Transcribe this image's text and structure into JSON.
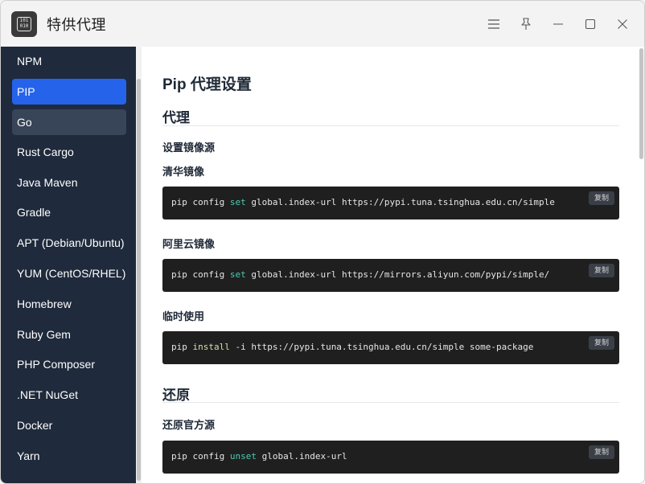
{
  "window": {
    "title": "特供代理",
    "app_icon_text": "101\n010"
  },
  "sidebar": {
    "items": [
      {
        "label": "NPM",
        "state": "normal"
      },
      {
        "label": "PIP",
        "state": "active"
      },
      {
        "label": "Go",
        "state": "hover"
      },
      {
        "label": "Rust Cargo",
        "state": "normal"
      },
      {
        "label": "Java Maven",
        "state": "normal"
      },
      {
        "label": "Gradle",
        "state": "normal"
      },
      {
        "label": "APT (Debian/Ubuntu)",
        "state": "normal"
      },
      {
        "label": "YUM (CentOS/RHEL)",
        "state": "normal"
      },
      {
        "label": "Homebrew",
        "state": "normal"
      },
      {
        "label": "Ruby Gem",
        "state": "normal"
      },
      {
        "label": "PHP Composer",
        "state": "normal"
      },
      {
        "label": ".NET NuGet",
        "state": "normal"
      },
      {
        "label": "Docker",
        "state": "normal"
      },
      {
        "label": "Yarn",
        "state": "normal"
      }
    ]
  },
  "main": {
    "page_title": "Pip 代理设置",
    "sections": [
      {
        "title": "代理",
        "subtitle": "设置镜像源",
        "blocks": [
          {
            "label": "清华镜像",
            "code_prefix": "pip config ",
            "code_keyword": "set",
            "code_rest": " global.index-url https://pypi.tuna.tsinghua.edu.cn/simple",
            "copy_label": "复制"
          },
          {
            "label": "阿里云镜像",
            "code_prefix": "pip config ",
            "code_keyword": "set",
            "code_rest": " global.index-url https://mirrors.aliyun.com/pypi/simple/",
            "copy_label": "复制"
          },
          {
            "label": "临时使用",
            "code_prefix": "pip ",
            "code_keyword": "install",
            "code_rest": " -i https://pypi.tuna.tsinghua.edu.cn/simple some-package",
            "copy_label": "复制"
          }
        ]
      },
      {
        "title": "还原",
        "blocks": [
          {
            "label": "还原官方源",
            "code_prefix": "pip config ",
            "code_keyword": "unset",
            "code_rest": " global.index-url",
            "copy_label": "复制"
          }
        ]
      }
    ]
  },
  "colors": {
    "sidebar_bg": "#1f2a3c",
    "active_item": "#2563eb",
    "hover_item": "#384457",
    "code_bg": "#1f1f1f",
    "keyword_set": "#4ec9b0",
    "keyword_install": "#dcdcaa"
  },
  "icons": [
    "menu-icon",
    "pin-icon",
    "minimize-icon",
    "maximize-icon",
    "close-icon"
  ]
}
